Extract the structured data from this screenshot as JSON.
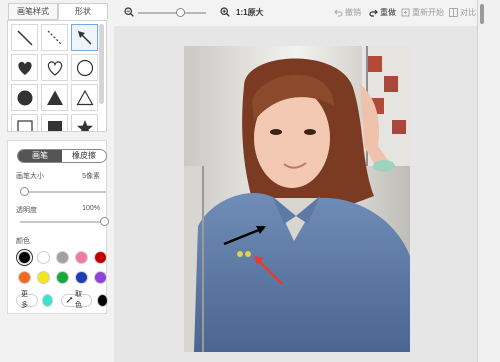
{
  "tabs": [
    {
      "label": "画笔样式",
      "active": false
    },
    {
      "label": "形状",
      "active": true
    }
  ],
  "shapes": [
    "line-icon",
    "dashed-line-icon",
    "arrow-icon",
    "heart-filled-icon",
    "heart-outline-icon",
    "circle-outline-icon",
    "circle-filled-icon",
    "triangle-filled-icon",
    "triangle-outline-icon",
    "square-outline-icon",
    "square-filled-icon",
    "star-filled-icon"
  ],
  "mode": {
    "brush": "画笔",
    "eraser": "橡皮擦"
  },
  "brush_size": {
    "label": "画笔大小",
    "value": "5像素"
  },
  "opacity": {
    "label": "透明度",
    "value": "100%"
  },
  "color_label": "颜色",
  "colors": [
    "#000000",
    "#ffffff",
    "#a0a0a0",
    "#f07aa6",
    "#c00000",
    "#f26a22",
    "#f4e61c",
    "#18a83c",
    "#1d3db3",
    "#8e44d6"
  ],
  "more_label": "更多",
  "more_color": "#3ee0d0",
  "picker_label": "取色",
  "current_color": "#000000",
  "toolbar": {
    "zoom_fit_label": "1:1原大",
    "undo": "撤销",
    "redo": "重做",
    "restart": "重新开始",
    "compare": "对比"
  }
}
